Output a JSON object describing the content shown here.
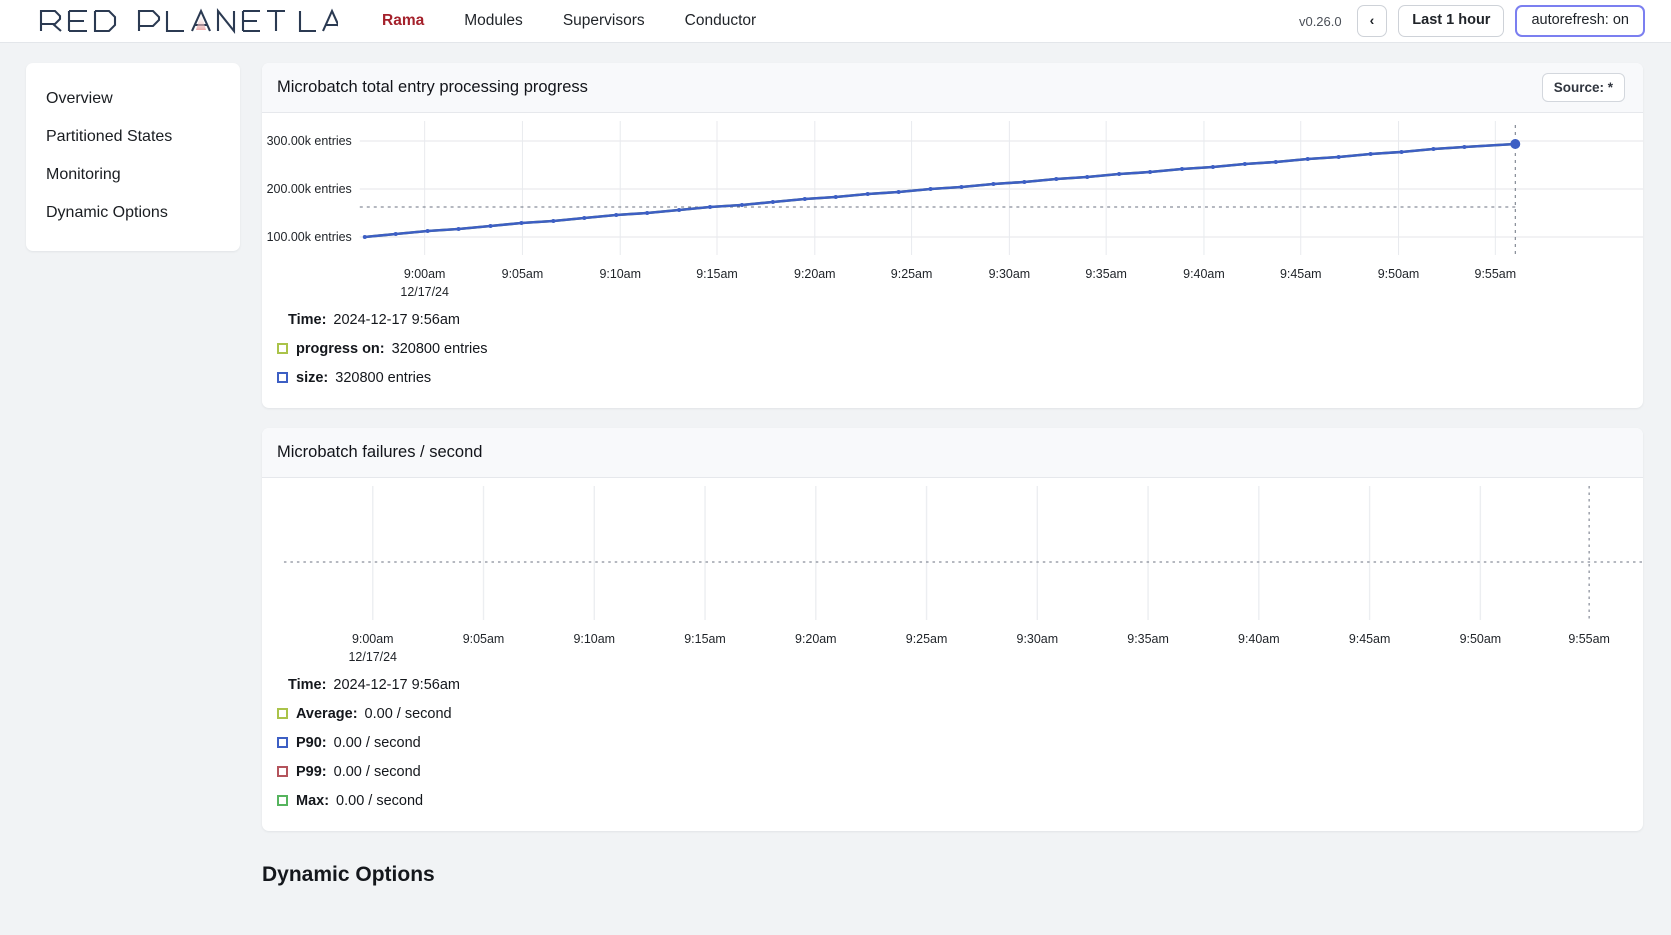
{
  "navbar": {
    "brand_text": "RED PLANET LABS",
    "links": [
      {
        "label": "Rama",
        "active": true
      },
      {
        "label": "Modules",
        "active": false
      },
      {
        "label": "Supervisors",
        "active": false
      },
      {
        "label": "Conductor",
        "active": false
      }
    ],
    "version": "v0.26.0",
    "prev_button": "‹",
    "range_button": "Last 1 hour",
    "autorefresh_button": "autorefresh: on",
    "accent_color": "#7b7ff0",
    "brand_accent": "#a4212b"
  },
  "sidebar": {
    "items": [
      {
        "label": "Overview"
      },
      {
        "label": "Partitioned States"
      },
      {
        "label": "Monitoring"
      },
      {
        "label": "Dynamic Options"
      }
    ]
  },
  "cards": [
    {
      "title": "Microbatch total entry processing progress",
      "source_button": "Source: *",
      "readout": [
        {
          "name": "time-row",
          "label": "Time:",
          "value": "2024-12-17 9:56am",
          "swatch": null
        },
        {
          "name": "progress-on-row",
          "label": "progress on:",
          "value": "320800 entries",
          "swatch": "#aac34a"
        },
        {
          "name": "size-row",
          "label": "size:",
          "value": "320800 entries",
          "swatch": "#3d5fc4"
        }
      ]
    },
    {
      "title": "Microbatch failures / second",
      "readout": [
        {
          "name": "time-row",
          "label": "Time:",
          "value": "2024-12-17 9:56am",
          "swatch": null
        },
        {
          "name": "average-row",
          "label": "Average:",
          "value": "0.00 / second",
          "swatch": "#aac34a"
        },
        {
          "name": "p90-row",
          "label": "P90:",
          "value": "0.00 / second",
          "swatch": "#3d5fc4"
        },
        {
          "name": "p99-row",
          "label": "P99:",
          "value": "0.00 / second",
          "swatch": "#b4545c"
        },
        {
          "name": "max-row",
          "label": "Max:",
          "value": "0.00 / second",
          "swatch": "#56b45e"
        }
      ]
    }
  ],
  "below_section_title": "Dynamic Options",
  "chart_data": [
    {
      "type": "line",
      "title": "Microbatch total entry processing progress",
      "xlabel": "12/17/24",
      "ylabel": "entries",
      "ytick_labels": [
        "100.00k entries",
        "200.00k entries",
        "300.00k entries"
      ],
      "ytick_values": [
        100000,
        200000,
        300000
      ],
      "ylim": [
        85000,
        330000
      ],
      "xtick_labels": [
        "9:00am",
        "9:05am",
        "9:10am",
        "9:15am",
        "9:20am",
        "9:25am",
        "9:30am",
        "9:35am",
        "9:40am",
        "9:45am",
        "9:50am",
        "9:55am"
      ],
      "grid": true,
      "legend_position": "below-chart",
      "cursor_time": "2024-12-17 9:56am",
      "series": [
        {
          "name": "progress on",
          "color": "#aac34a",
          "values": [
            118000,
            124000,
            130000,
            136000,
            142000,
            148000,
            154000,
            160000,
            166000,
            172000,
            178000,
            184000,
            190000,
            196000,
            202000,
            208000,
            214000,
            220000,
            226000,
            232000,
            238000,
            244000,
            250000,
            256000,
            262000,
            268000,
            273000,
            278000,
            283000,
            288000,
            293000,
            298000,
            303000,
            308000,
            313000,
            318000,
            320800
          ]
        },
        {
          "name": "size",
          "color": "#3d5fc4",
          "values": [
            118000,
            124000,
            130000,
            136000,
            142000,
            148000,
            154000,
            160000,
            166000,
            172000,
            178000,
            184000,
            190000,
            196000,
            202000,
            208000,
            214000,
            220000,
            226000,
            232000,
            238000,
            244000,
            250000,
            256000,
            262000,
            268000,
            273000,
            278000,
            283000,
            288000,
            293000,
            298000,
            303000,
            308000,
            313000,
            318000,
            320800
          ]
        }
      ]
    },
    {
      "type": "line",
      "title": "Microbatch failures / second",
      "xlabel": "12/17/24",
      "ylabel": "/ second",
      "ytick_labels": [],
      "ylim": [
        0,
        0
      ],
      "xtick_labels": [
        "9:00am",
        "9:05am",
        "9:10am",
        "9:15am",
        "9:20am",
        "9:25am",
        "9:30am",
        "9:35am",
        "9:40am",
        "9:45am",
        "9:50am",
        "9:55am"
      ],
      "grid": true,
      "legend_position": "below-chart",
      "cursor_time": "2024-12-17 9:56am",
      "series": [
        {
          "name": "Average",
          "color": "#aac34a",
          "values": [
            0
          ]
        },
        {
          "name": "P90",
          "color": "#3d5fc4",
          "values": [
            0
          ]
        },
        {
          "name": "P99",
          "color": "#b4545c",
          "values": [
            0
          ]
        },
        {
          "name": "Max",
          "color": "#56b45e",
          "values": [
            0
          ]
        }
      ]
    }
  ]
}
